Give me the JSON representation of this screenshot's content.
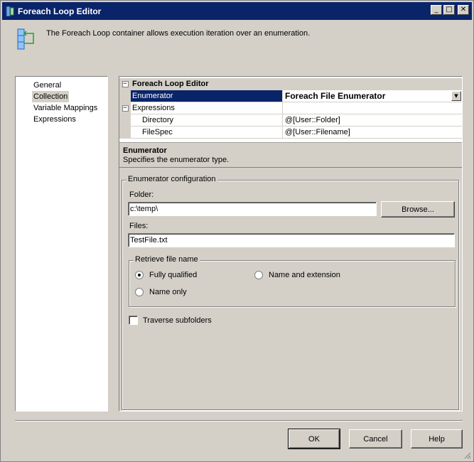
{
  "window": {
    "title": "Foreach Loop Editor"
  },
  "header": {
    "description": "The Foreach Loop container allows execution iteration over an enumeration."
  },
  "sidebar": {
    "items": [
      {
        "label": "General"
      },
      {
        "label": "Collection"
      },
      {
        "label": "Variable Mappings"
      },
      {
        "label": "Expressions"
      }
    ]
  },
  "propgrid": {
    "category": "Foreach Loop Editor",
    "enumerator": {
      "name": "Enumerator",
      "value": "Foreach File Enumerator"
    },
    "expressions": {
      "label": "Expressions"
    },
    "directory": {
      "name": "Directory",
      "value": "@[User::Folder]"
    },
    "filespec": {
      "name": "FileSpec",
      "value": "@[User::Filename]"
    }
  },
  "description": {
    "title": "Enumerator",
    "text": "Specifies the enumerator type."
  },
  "config": {
    "legend": "Enumerator configuration",
    "folder_label": "Folder:",
    "folder_value": "c:\\temp\\",
    "browse_label": "Browse...",
    "files_label": "Files:",
    "files_value": "TestFile.txt",
    "retrieve": {
      "legend": "Retrieve file name",
      "options": [
        {
          "label": "Fully qualified",
          "selected": true
        },
        {
          "label": "Name and extension",
          "selected": false
        },
        {
          "label": "Name only",
          "selected": false
        }
      ]
    },
    "traverse_label": "Traverse subfolders"
  },
  "buttons": {
    "ok": "OK",
    "cancel": "Cancel",
    "help": "Help"
  },
  "colors": {
    "titlebar": "#0a246a",
    "selection": "#0a246a",
    "face": "#d4d0c8"
  }
}
